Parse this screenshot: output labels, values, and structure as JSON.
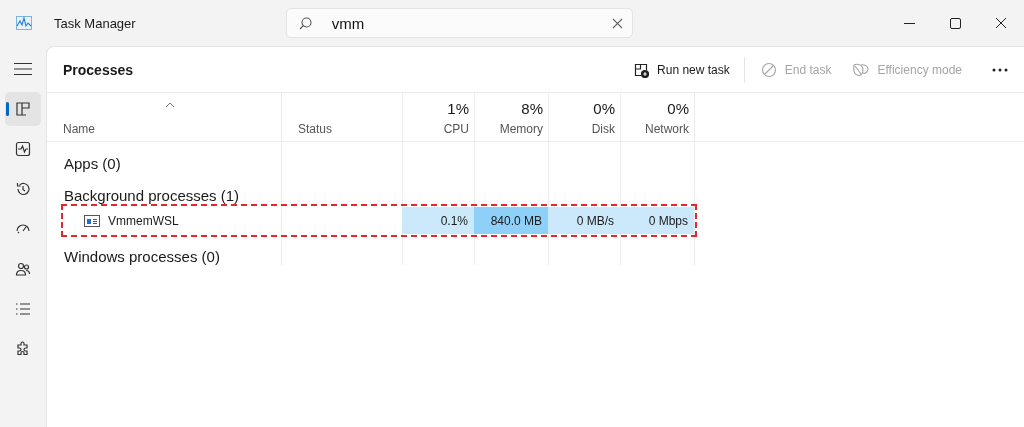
{
  "window": {
    "title": "Task Manager"
  },
  "search": {
    "value": "vmm"
  },
  "sidebar": {
    "items": [
      {
        "kind": "processes",
        "selected": true
      },
      {
        "kind": "performance",
        "selected": false
      },
      {
        "kind": "history",
        "selected": false
      },
      {
        "kind": "startup",
        "selected": false
      },
      {
        "kind": "users",
        "selected": false
      },
      {
        "kind": "details",
        "selected": false
      },
      {
        "kind": "services",
        "selected": false
      }
    ]
  },
  "page": {
    "title": "Processes"
  },
  "toolbar": [
    {
      "kind": "run",
      "label": "Run new task",
      "disabled": false
    },
    {
      "kind": "end",
      "label": "End task",
      "disabled": true
    },
    {
      "kind": "efficiency",
      "label": "Efficiency mode",
      "disabled": true
    }
  ],
  "table": {
    "columns": [
      {
        "label": "Name"
      },
      {
        "label": "Status"
      },
      {
        "label": "CPU",
        "total": "1%"
      },
      {
        "label": "Memory",
        "total": "8%"
      },
      {
        "label": "Disk",
        "total": "0%"
      },
      {
        "label": "Network",
        "total": "0%"
      }
    ],
    "groups": [
      {
        "title": "Apps (0)"
      },
      {
        "title": "Background processes (1)",
        "rows": [
          {
            "name": "VmmemWSL",
            "highlighted": true,
            "cells": [
              {
                "value": "0.1%",
                "color": "#cce8fb"
              },
              {
                "value": "840.0 MB",
                "color": "#8fd0f8"
              },
              {
                "value": "0 MB/s",
                "color": "#cce8fb"
              },
              {
                "value": "0 Mbps",
                "color": "#cce8fb"
              }
            ]
          }
        ]
      },
      {
        "title": "Windows processes (0)"
      }
    ]
  }
}
